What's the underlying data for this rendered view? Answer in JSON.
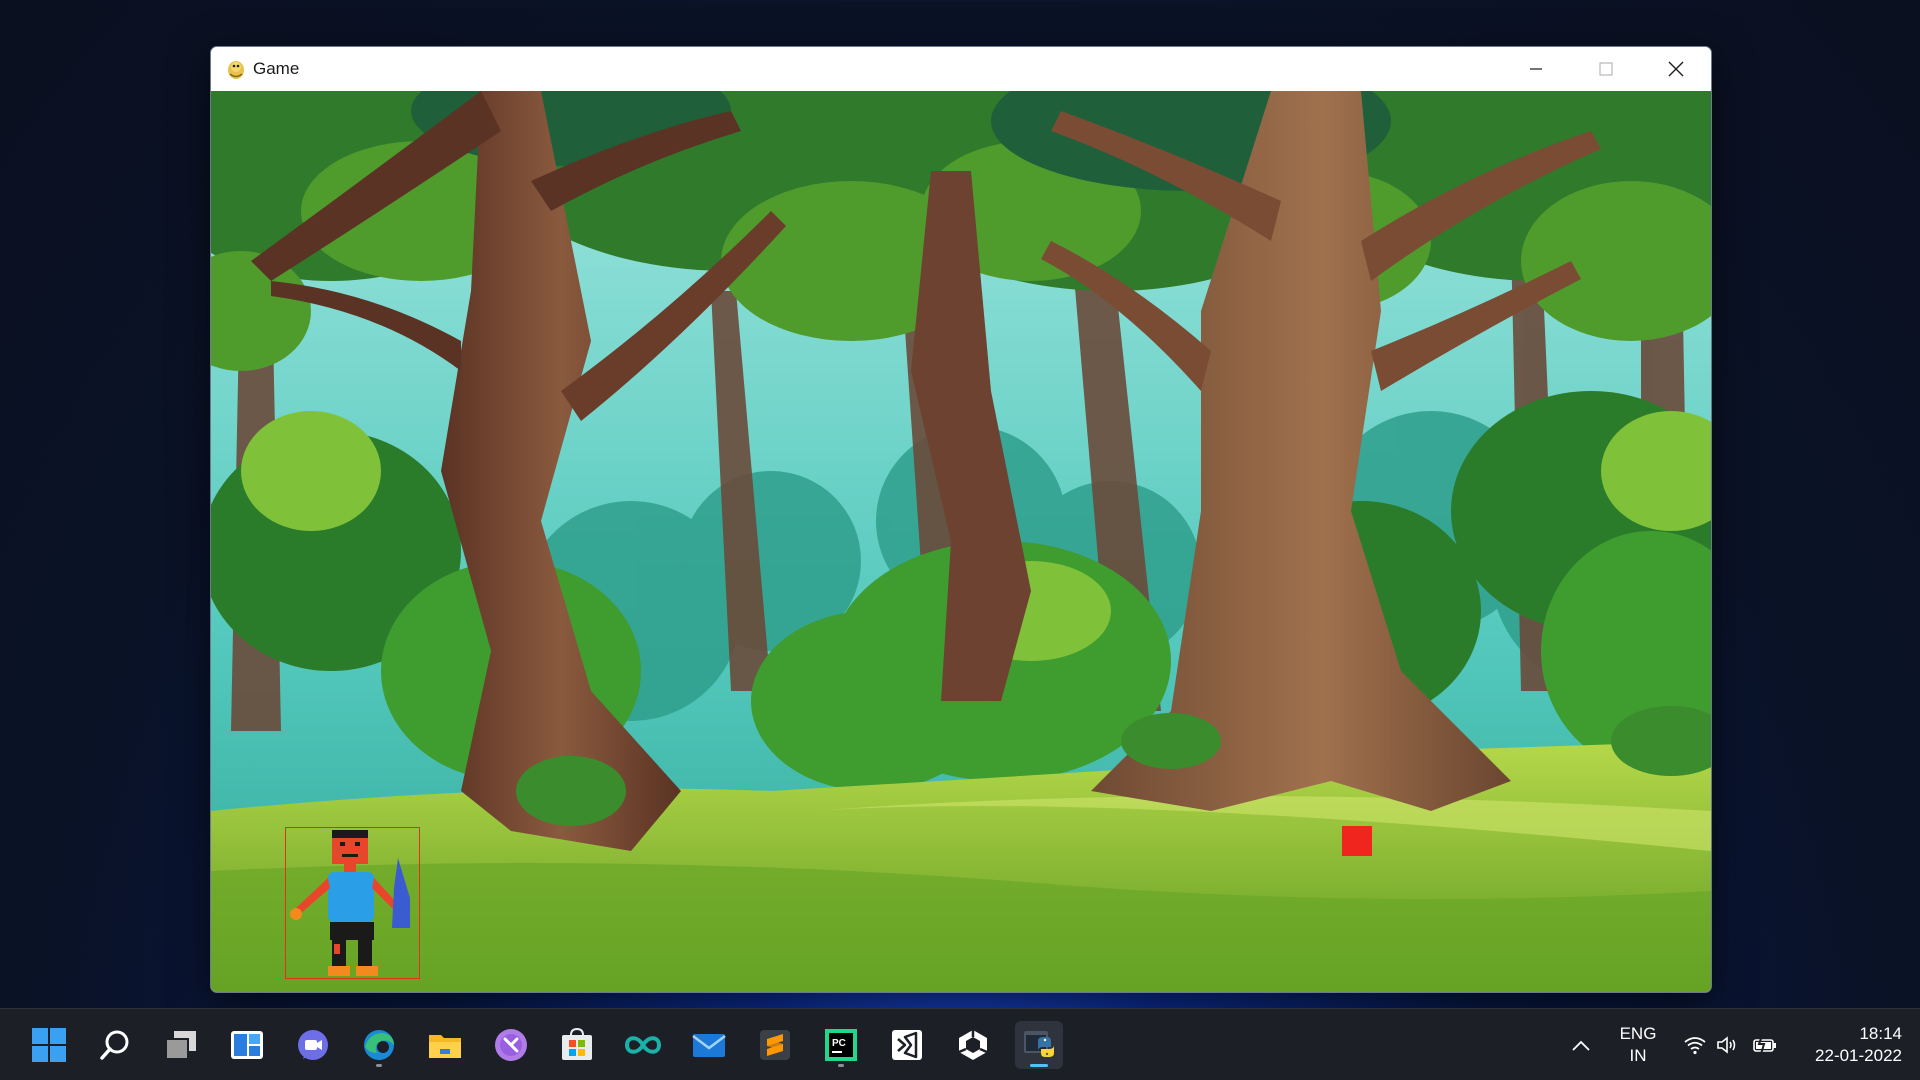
{
  "window": {
    "title": "Game"
  },
  "game": {
    "player": {
      "label": ""
    },
    "enemy": {}
  },
  "taskbar": {
    "apps": [
      {
        "name": "start"
      },
      {
        "name": "search"
      },
      {
        "name": "task-view"
      },
      {
        "name": "widgets"
      },
      {
        "name": "teams-chat"
      },
      {
        "name": "edge"
      },
      {
        "name": "file-explorer"
      },
      {
        "name": "purple-app"
      },
      {
        "name": "microsoft-store"
      },
      {
        "name": "arduino"
      },
      {
        "name": "mail"
      },
      {
        "name": "sublime-text"
      },
      {
        "name": "pycharm"
      },
      {
        "name": "visual-studio"
      },
      {
        "name": "unity"
      },
      {
        "name": "python"
      }
    ],
    "language": {
      "line1": "ENG",
      "line2": "IN"
    },
    "clock": {
      "time": "18:14",
      "date": "22-01-2022"
    }
  }
}
